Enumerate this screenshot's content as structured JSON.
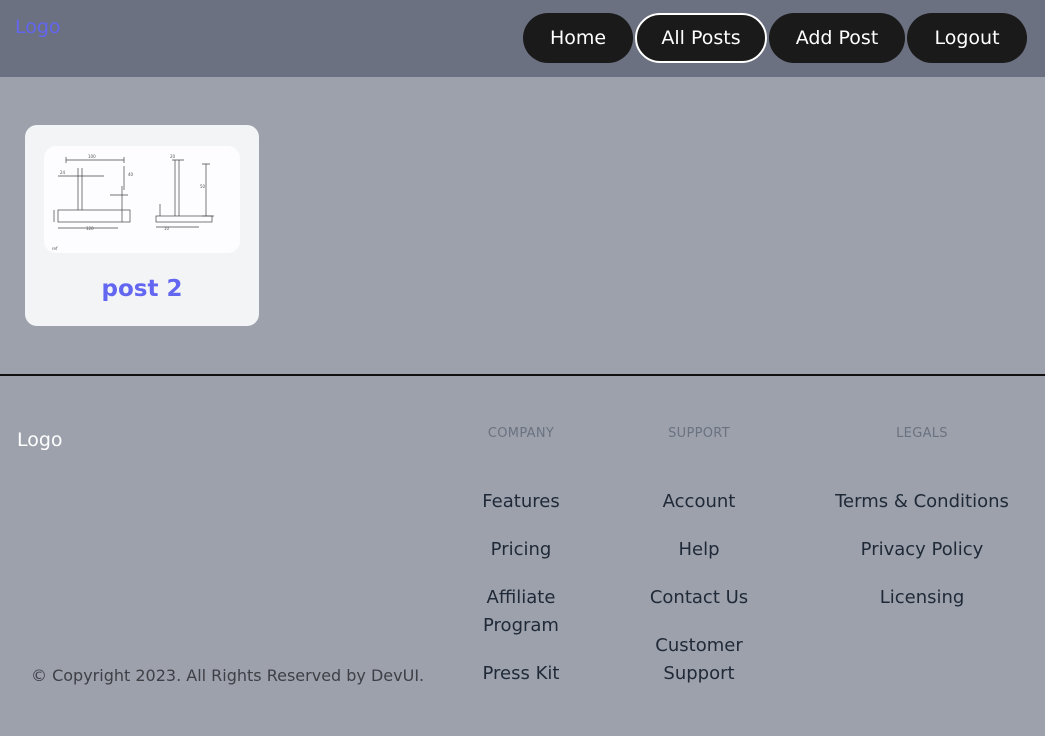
{
  "header": {
    "logo": "Logo",
    "nav": [
      {
        "label": "Home",
        "active": false
      },
      {
        "label": "All Posts",
        "active": true
      },
      {
        "label": "Add Post",
        "active": false
      },
      {
        "label": "Logout",
        "active": false
      }
    ]
  },
  "posts": [
    {
      "title": "post 2",
      "thumbnail_icon": "technical-drawing-thumbnail-icon"
    }
  ],
  "footer": {
    "logo": "Logo",
    "copyright": "© Copyright 2023. All Rights Reserved by DevUI.",
    "columns": [
      {
        "heading": "COMPANY",
        "links": [
          "Features",
          "Pricing",
          "Affiliate Program",
          "Press Kit"
        ]
      },
      {
        "heading": "SUPPORT",
        "links": [
          "Account",
          "Help",
          "Contact Us",
          "Customer Support"
        ]
      },
      {
        "heading": "LEGALS",
        "links": [
          "Terms & Conditions",
          "Privacy Policy",
          "Licensing"
        ]
      }
    ]
  },
  "colors": {
    "accent": "#6366f1",
    "header_bg": "#6b7181",
    "page_bg": "#9ca1ac",
    "button_bg": "#1a1a1a"
  }
}
